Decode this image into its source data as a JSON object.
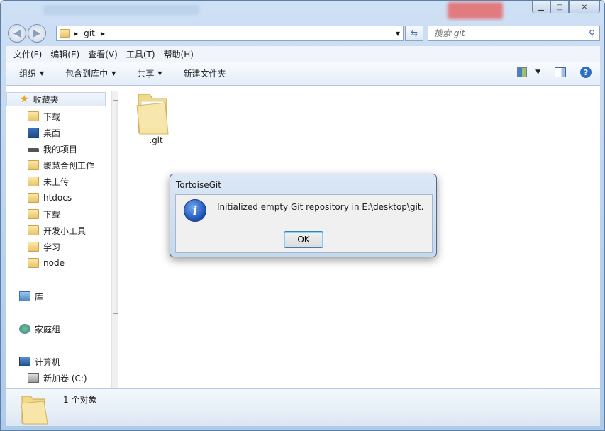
{
  "window": {
    "min_icon": "minimize-icon",
    "max_icon": "maximize-icon",
    "close_icon": "close-icon"
  },
  "address": {
    "path_segment": "git",
    "search_placeholder": "搜索 git"
  },
  "menu": [
    "文件(F)",
    "编辑(E)",
    "查看(V)",
    "工具(T)",
    "帮助(H)"
  ],
  "toolbar": {
    "organize": "组织",
    "include_library": "包含到库中",
    "share": "共享",
    "new_folder": "新建文件夹"
  },
  "nav": {
    "favorites": "收藏夹",
    "fav_items": [
      "下载",
      "桌面",
      "我的项目",
      "聚慧合创工作",
      "未上传",
      "htdocs",
      "下载",
      "开发小工具",
      "学习",
      "node"
    ],
    "library": "库",
    "homegroup": "家庭组",
    "computer": "计算机",
    "drive": "新加卷 (C:)"
  },
  "content": {
    "items": [
      {
        "name": ".git",
        "icon": "folder-icon"
      }
    ]
  },
  "status": {
    "count_text": "1 个对象"
  },
  "dialog": {
    "title": "TortoiseGit",
    "message": "Initialized empty Git repository in E:\\desktop\\git.",
    "ok_label": "OK",
    "icon": "info-icon"
  },
  "colors": {
    "accent": "#1c4fb3",
    "frame": "#b9d1ee"
  }
}
